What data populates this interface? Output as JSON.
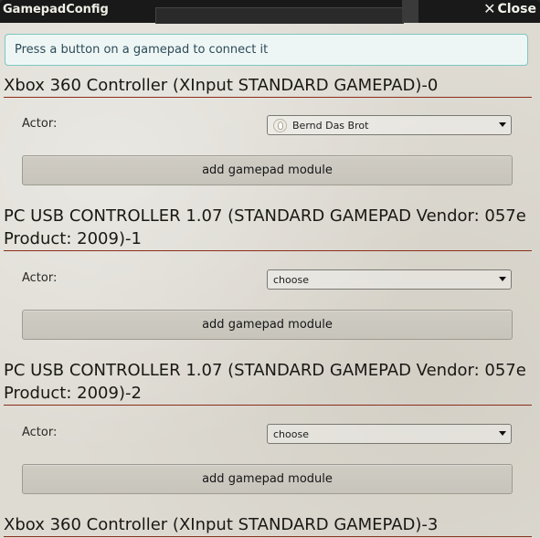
{
  "window": {
    "title": "GamepadConfig",
    "close_label": "Close",
    "close_icon": "close-icon"
  },
  "notice": {
    "text": "Press a button on a gamepad to connect it"
  },
  "gamepads": [
    {
      "title": "Xbox 360 Controller (XInput STANDARD GAMEPAD)-0",
      "actor_label": "Actor:",
      "actor_value": "Bernd Das Brot",
      "add_label": "add gamepad module"
    },
    {
      "title_line1": "PC USB CONTROLLER 1.07 (STANDARD GAMEPAD Vendor: 057e",
      "title_line2": "Product: 2009)-1",
      "actor_label": "Actor:",
      "actor_value": "choose",
      "add_label": "add gamepad module"
    },
    {
      "title_line1": "PC USB CONTROLLER 1.07 (STANDARD GAMEPAD Vendor: 057e",
      "title_line2": "Product: 2009)-2",
      "actor_label": "Actor:",
      "actor_value": "choose",
      "add_label": "add gamepad module"
    },
    {
      "title": "Xbox 360 Controller (XInput STANDARD GAMEPAD)-3"
    }
  ],
  "colors": {
    "notice_border": "#7fc6c0",
    "section_rule": "#8b2e1a",
    "titlebar": "#191919"
  }
}
